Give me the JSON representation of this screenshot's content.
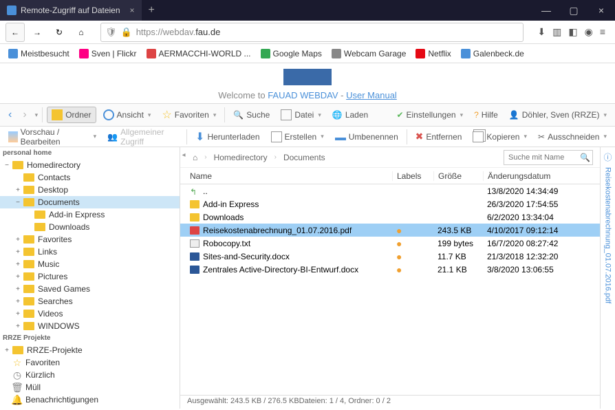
{
  "browser": {
    "tab_title": "Remote-Zugriff auf Dateien",
    "url_prefix": "https://webdav.",
    "url_domain": "fau.de"
  },
  "bookmarks": [
    {
      "label": "Meistbesucht",
      "color": "#4a90d9"
    },
    {
      "label": "Sven | Flickr",
      "color": "#ff0084"
    },
    {
      "label": "AERMACCHI-WORLD ...",
      "color": "#d44"
    },
    {
      "label": "Google Maps",
      "color": "#34a853"
    },
    {
      "label": "Webcam Garage",
      "color": "#888"
    },
    {
      "label": "Netflix",
      "color": "#e50914"
    },
    {
      "label": "Galenbeck.de",
      "color": "#4a90d9"
    }
  ],
  "welcome": {
    "text_pre": "Welcome to ",
    "text_bold": "FAUAD WEBDAV",
    "text_sep": " - ",
    "manual": "User Manual"
  },
  "tb1": {
    "ordner": "Ordner",
    "ansicht": "Ansicht",
    "favoriten": "Favoriten",
    "suche": "Suche",
    "datei": "Datei",
    "laden": "Laden",
    "einstellungen": "Einstellungen",
    "hilfe": "Hilfe",
    "user": "Döhler, Sven (RRZE)"
  },
  "tb2": {
    "vorschau": "Vorschau / Bearbeiten",
    "zugriff": "Allgemeiner Zugriff",
    "herunterladen": "Herunterladen",
    "erstellen": "Erstellen",
    "umbenennen": "Umbenennen",
    "entfernen": "Entfernen",
    "kopieren": "Kopieren",
    "ausschneiden": "Ausschneiden"
  },
  "tree": {
    "section1": "personal home",
    "section2": "RRZE Projekte",
    "home": "Homedirectory",
    "contacts": "Contacts",
    "desktop": "Desktop",
    "documents": "Documents",
    "addin": "Add-in Express",
    "downloads": "Downloads",
    "favorites": "Favorites",
    "links": "Links",
    "music": "Music",
    "pictures": "Pictures",
    "saved": "Saved Games",
    "searches": "Searches",
    "videos": "Videos",
    "windows": "WINDOWS",
    "rrze": "RRZE-Projekte",
    "favoriten": "Favoriten",
    "kuerzlich": "Kürzlich",
    "muell": "Müll",
    "benach": "Benachrichtigungen"
  },
  "breadcrumb": {
    "home": "Homedirectory",
    "doc": "Documents"
  },
  "search_placeholder": "Suche mit Name",
  "cols": {
    "name": "Name",
    "labels": "Labels",
    "size": "Größe",
    "date": "Änderungsdatum"
  },
  "files": [
    {
      "name": "..",
      "type": "up",
      "label": "",
      "size": "",
      "date": "13/8/2020 14:34:49"
    },
    {
      "name": "Add-in Express",
      "type": "folder",
      "label": "",
      "size": "",
      "date": "26/3/2020 17:54:55"
    },
    {
      "name": "Downloads",
      "type": "folder",
      "label": "",
      "size": "",
      "date": "6/2/2020 13:34:04"
    },
    {
      "name": "Reisekostenabrechnung_01.07.2016.pdf",
      "type": "pdf",
      "label": "●",
      "size": "243.5 KB",
      "date": "4/10/2017 09:12:14",
      "selected": true
    },
    {
      "name": "Robocopy.txt",
      "type": "txt",
      "label": "●",
      "size": "199 bytes",
      "date": "16/7/2020 08:27:42"
    },
    {
      "name": "Sites-and-Security.docx",
      "type": "doc",
      "label": "●",
      "size": "11.7 KB",
      "date": "21/3/2018 12:32:20"
    },
    {
      "name": "Zentrales Active-Directory-BI-Entwurf.docx",
      "type": "doc",
      "label": "●",
      "size": "21.1 KB",
      "date": "3/8/2020 13:06:55"
    }
  ],
  "status": "Ausgewählt: 243.5 KB / 276.5 KBDateien: 1 / 4, Ordner: 0 / 2",
  "sidepanel": "Reisekostenabrechnung_01.07.2016.pdf"
}
